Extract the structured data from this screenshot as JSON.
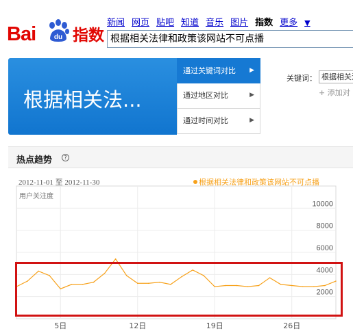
{
  "logo": {
    "text_bai": "Bai",
    "text_du": "du",
    "text_product": "指数"
  },
  "nav": {
    "items": [
      "新闻",
      "网页",
      "贴吧",
      "知道",
      "音乐",
      "图片",
      "指数",
      "更多"
    ],
    "active": "指数",
    "more_caret": "▼"
  },
  "search": {
    "value": "根据相关法律和政策该网站不可点播"
  },
  "banner": {
    "title": "根据相关法..."
  },
  "tabs": [
    {
      "label": "通过关键词对比",
      "arrow": "▶"
    },
    {
      "label": "通过地区对比",
      "arrow": "▶"
    },
    {
      "label": "通过时间对比",
      "arrow": "▶"
    }
  ],
  "keyword": {
    "label": "关键词：",
    "value": "根据相关法",
    "add_label": "添加对",
    "add_icon": "+"
  },
  "section": {
    "title": "热点趋势",
    "help": "?"
  },
  "chart_meta": {
    "date_range": "2012-11-01 至 2012-11-30",
    "legend": "根据相关法律和政策该网站不可点播",
    "ylabel": "用户关注度"
  },
  "colors": {
    "series": "#f7a11a",
    "highlight": "#d11212",
    "accent": "#1679d3",
    "brand": "#e10602"
  },
  "chart_data": {
    "type": "line",
    "title": "",
    "xlabel": "",
    "ylabel": "用户关注度",
    "x_tick_labels": [
      "5日",
      "12日",
      "19日",
      "26日"
    ],
    "x_tick_days": [
      5,
      12,
      19,
      26
    ],
    "y_tick_labels": [
      "2000",
      "4000",
      "6000",
      "8000",
      "10000"
    ],
    "y_tick_values": [
      2000,
      4000,
      6000,
      8000,
      10000
    ],
    "xlim": [
      1,
      30
    ],
    "ylim": [
      0,
      12000
    ],
    "grid": true,
    "legend_position": "top-right",
    "series": [
      {
        "name": "根据相关法律和政策该网站不可点播",
        "x": [
          1,
          2,
          3,
          4,
          5,
          6,
          7,
          8,
          9,
          10,
          11,
          12,
          13,
          14,
          15,
          16,
          17,
          18,
          19,
          20,
          21,
          22,
          23,
          24,
          25,
          26,
          27,
          28,
          29,
          30
        ],
        "values": [
          2900,
          3400,
          4300,
          3900,
          2700,
          3100,
          3100,
          3300,
          4100,
          5400,
          3900,
          3200,
          3200,
          3300,
          3100,
          3800,
          4400,
          3900,
          2900,
          3000,
          3000,
          2900,
          3000,
          3700,
          3100,
          3000,
          2900,
          2900,
          3000,
          3400
        ]
      }
    ]
  }
}
